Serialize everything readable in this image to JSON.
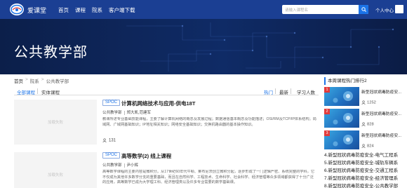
{
  "header": {
    "brand": "爱课堂",
    "nav": [
      "首页",
      "课程",
      "院系",
      "客户端下载"
    ],
    "search_placeholder": "请输入课程名",
    "user_label": "个人中心"
  },
  "banner": {
    "title": "公共教学部"
  },
  "breadcrumb": [
    "首页",
    ">",
    "院系",
    ">",
    "公共教学部"
  ],
  "filter": {
    "tabs": [
      "全部课程",
      "实体课程"
    ],
    "sorts": [
      "热门",
      "最新",
      "学习人数"
    ]
  },
  "courses": [
    {
      "thumb_text": "加载失败",
      "tag": "SPOC",
      "title": "计算机网络技术与应用-供电18T",
      "department": "公共教学部",
      "teacher": "郑大凯,范建军",
      "description": "教课所述专业基础技能课程，主要了解计算机网络的概念及发展过程；数据通信基本概念及功能描述；OSI/RM及TCP/IP体系结构；局域网、广域网基础知识；IP地址相关知识；网络安全基础知识；交换机路由器的基本操作知识。",
      "views": "131"
    },
    {
      "thumb_text": "加载失败",
      "tag": "SPOC",
      "title": "高等数学(2) 线上课程",
      "department": "公共教学部",
      "teacher": "尹小辉",
      "description": "高等数学课程的主要内容是微积分。从17世纪60年代牛顿、莱布尼茨创立微积分起，逐步形成了一门逻辑严密、系统完整的学科，它不仅成为其他许多数学分支的重要基础，而且在自然科学、工程技术、生命科学、社会科学、经济管理等众多领域都获得了十分广泛的应用，高等数学已成为大学理工科、经济管理类以及许多专业需要的数学基础课。",
      "views": ""
    }
  ],
  "sidebar": {
    "title": "本周课程热门排行2",
    "items": [
      {
        "rank": "1",
        "title": "新型冠状病毒防疫安...",
        "views": "1252"
      },
      {
        "rank": "2",
        "title": "新型冠状病毒防疫安...",
        "views": "828"
      },
      {
        "rank": "3",
        "title": "新型冠状病毒防疫安...",
        "views": "824"
      }
    ],
    "text_items": [
      "4.新型冠状病毒防疫安全-电气工程系",
      "5.新型冠状病毒防疫安全-城轨车辆系",
      "6.新型冠状病毒防疫安全-交通工程系",
      "7.新型冠状病毒防疫安全-经济管理系",
      "8.新型冠状病毒防疫安全-公共教学部"
    ]
  },
  "colors": {
    "nav_bg": "#1b3f93",
    "accent": "#1b73e8",
    "rank_badge": "#e23b3b"
  }
}
